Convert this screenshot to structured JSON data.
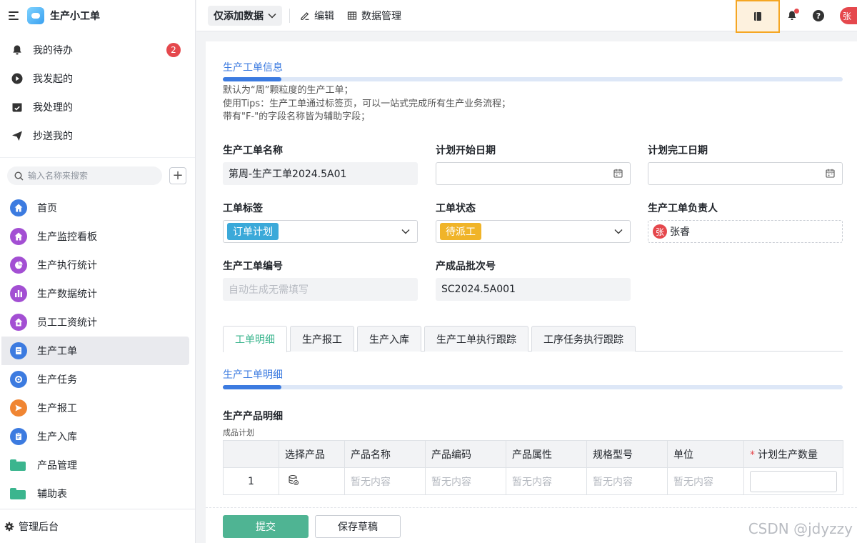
{
  "app": {
    "title": "生产小工单"
  },
  "sidebar": {
    "top_items": [
      {
        "label": "我的待办",
        "badge": "2",
        "icon": "bell-icon"
      },
      {
        "label": "我发起的",
        "icon": "play-icon"
      },
      {
        "label": "我处理的",
        "icon": "inbox-check-icon"
      },
      {
        "label": "抄送我的",
        "icon": "send-icon"
      }
    ],
    "search": {
      "placeholder": "输入名称来搜索"
    },
    "nav": [
      {
        "label": "首页",
        "icon": "home-icon",
        "color": "#3c7be0"
      },
      {
        "label": "生产监控看板",
        "icon": "home-icon",
        "color": "#a34fd3"
      },
      {
        "label": "生产执行统计",
        "icon": "pie-chart-icon",
        "color": "#a34fd3"
      },
      {
        "label": "生产数据统计",
        "icon": "bar-chart-icon",
        "color": "#a34fd3"
      },
      {
        "label": "员工工资统计",
        "icon": "home-icon",
        "color": "#a34fd3"
      },
      {
        "label": "生产工单",
        "icon": "document-icon",
        "color": "#3c7be0",
        "active": true
      },
      {
        "label": "生产任务",
        "icon": "target-icon",
        "color": "#3c7be0"
      },
      {
        "label": "生产报工",
        "icon": "send-icon",
        "color": "#f08532"
      },
      {
        "label": "生产入库",
        "icon": "clipboard-icon",
        "color": "#3c7be0"
      },
      {
        "label": "产品管理",
        "icon": "folder-icon",
        "color": "#3bb58e"
      },
      {
        "label": "辅助表",
        "icon": "folder-icon",
        "color": "#3bb58e"
      }
    ],
    "footer": "管理后台"
  },
  "toolbar": {
    "view": "仅添加数据",
    "edit": "编辑",
    "data_manage": "数据管理",
    "avatar": "张"
  },
  "form": {
    "section_title": "生产工单信息",
    "desc": [
      "默认为“周”颗粒度的生产工单；",
      "使用Tips：生产工单通过标签页，可以一站式完成所有生产业务流程；",
      "带有\"F-\"的字段名称皆为辅助字段；"
    ],
    "fields": {
      "name": {
        "label": "生产工单名称",
        "value": "第周-生产工单2024.5A01"
      },
      "start": {
        "label": "计划开始日期",
        "value": ""
      },
      "end": {
        "label": "计划完工日期",
        "value": ""
      },
      "tag": {
        "label": "工单标签",
        "value": "订单计划",
        "color": "#3ba9d9"
      },
      "status": {
        "label": "工单状态",
        "value": "待派工",
        "color": "#f0b429"
      },
      "owner": {
        "label": "生产工单负责人",
        "value": "张睿",
        "avatar": "张"
      },
      "code": {
        "label": "生产工单编号",
        "placeholder": "自动生成无需填写"
      },
      "batch": {
        "label": "产成品批次号",
        "value": "SC2024.5A001"
      }
    }
  },
  "tabs": [
    "工单明细",
    "生产报工",
    "生产入库",
    "生产工单执行跟踪",
    "工序任务执行跟踪"
  ],
  "detail": {
    "section_title": "生产工单明细",
    "sub_title": "生产产品明细",
    "sub_caption": "成品计划",
    "columns": [
      "",
      "选择产品",
      "产品名称",
      "产品编码",
      "产品属性",
      "规格型号",
      "单位",
      "计划生产数量"
    ],
    "required_mark": "*",
    "row": {
      "index": "1",
      "empty": "暂无内容"
    }
  },
  "actions": {
    "submit": "提交",
    "draft": "保存草稿"
  },
  "watermark": "CSDN @jdyzzy",
  "colors": {
    "accent_blue": "#3c7be0",
    "accent_green": "#4fb493",
    "highlight": "#f5a623"
  }
}
